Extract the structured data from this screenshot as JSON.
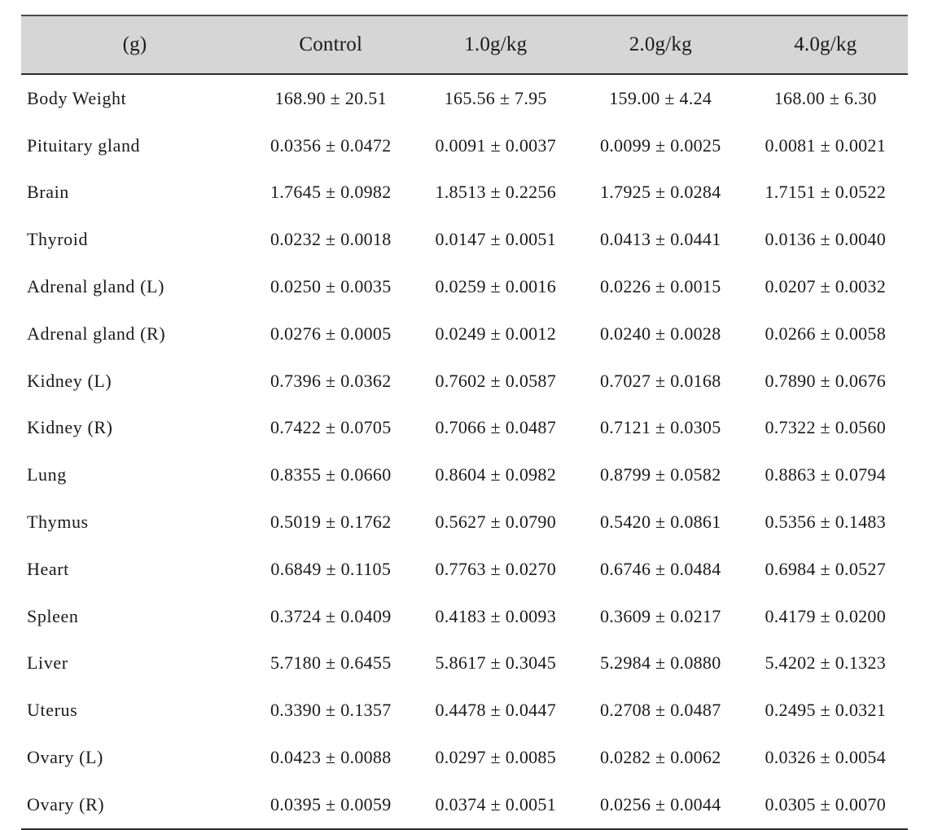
{
  "table": {
    "unit_header": "(g)",
    "columns": [
      "(g)",
      "Control",
      "1.0g/kg",
      "2.0g/kg",
      "4.0g/kg"
    ],
    "header_background": "#d6d6d6",
    "rows": [
      {
        "label": "Body Weight",
        "values": [
          "168.90 ± 20.51",
          "165.56 ± 7.95",
          "159.00 ± 4.24",
          "168.00 ± 6.30"
        ]
      },
      {
        "label": "Pituitary gland",
        "values": [
          "0.0356 ± 0.0472",
          "0.0091 ± 0.0037",
          "0.0099 ± 0.0025",
          "0.0081 ± 0.0021"
        ]
      },
      {
        "label": "Brain",
        "values": [
          "1.7645 ± 0.0982",
          "1.8513 ± 0.2256",
          "1.7925 ± 0.0284",
          "1.7151 ± 0.0522"
        ]
      },
      {
        "label": "Thyroid",
        "values": [
          "0.0232 ± 0.0018",
          "0.0147 ± 0.0051",
          "0.0413 ± 0.0441",
          "0.0136 ± 0.0040"
        ]
      },
      {
        "label": "Adrenal gland (L)",
        "values": [
          "0.0250 ± 0.0035",
          "0.0259 ± 0.0016",
          "0.0226 ± 0.0015",
          "0.0207 ± 0.0032"
        ]
      },
      {
        "label": "Adrenal gland (R)",
        "values": [
          "0.0276 ± 0.0005",
          "0.0249 ± 0.0012",
          "0.0240 ± 0.0028",
          "0.0266 ± 0.0058"
        ]
      },
      {
        "label": "Kidney (L)",
        "values": [
          "0.7396 ± 0.0362",
          "0.7602 ± 0.0587",
          "0.7027 ± 0.0168",
          "0.7890 ± 0.0676"
        ]
      },
      {
        "label": "Kidney (R)",
        "values": [
          "0.7422 ± 0.0705",
          "0.7066 ± 0.0487",
          "0.7121 ± 0.0305",
          "0.7322 ± 0.0560"
        ]
      },
      {
        "label": "Lung",
        "values": [
          "0.8355 ± 0.0660",
          "0.8604 ± 0.0982",
          "0.8799 ± 0.0582",
          "0.8863 ± 0.0794"
        ]
      },
      {
        "label": "Thymus",
        "values": [
          "0.5019 ± 0.1762",
          "0.5627 ± 0.0790",
          "0.5420 ± 0.0861",
          "0.5356 ± 0.1483"
        ]
      },
      {
        "label": "Heart",
        "values": [
          "0.6849 ± 0.1105",
          "0.7763 ± 0.0270",
          "0.6746 ± 0.0484",
          "0.6984 ± 0.0527"
        ]
      },
      {
        "label": "Spleen",
        "values": [
          "0.3724 ± 0.0409",
          "0.4183 ± 0.0093",
          "0.3609 ± 0.0217",
          "0.4179 ± 0.0200"
        ]
      },
      {
        "label": "Liver",
        "values": [
          "5.7180 ± 0.6455",
          "5.8617 ± 0.3045",
          "5.2984 ± 0.0880",
          "5.4202 ± 0.1323"
        ]
      },
      {
        "label": "Uterus",
        "values": [
          "0.3390 ± 0.1357",
          "0.4478 ± 0.0447",
          "0.2708 ± 0.0487",
          "0.2495 ± 0.0321"
        ]
      },
      {
        "label": "Ovary (L)",
        "values": [
          "0.0423 ± 0.0088",
          "0.0297 ± 0.0085",
          "0.0282 ± 0.0062",
          "0.0326 ± 0.0054"
        ]
      },
      {
        "label": "Ovary (R)",
        "values": [
          "0.0395 ± 0.0059",
          "0.0374 ± 0.0051",
          "0.0256 ± 0.0044",
          "0.0305 ± 0.0070"
        ]
      }
    ]
  }
}
